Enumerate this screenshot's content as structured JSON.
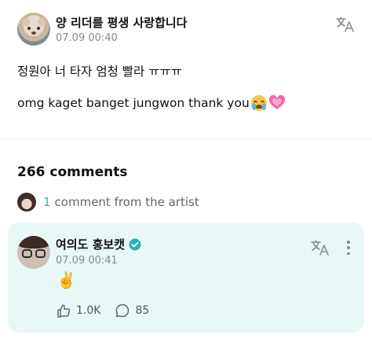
{
  "post": {
    "author": "양 리더를 평생 사랑합니다",
    "timestamp": "07.09 00:40",
    "body_line1": "정원아 너 타자 엄청 빨라 ㅠㅠㅠ",
    "body_line2": "omg kaget banget jungwon thank you",
    "emojis": [
      "loudly-crying-face",
      "growing-heart"
    ]
  },
  "comments": {
    "count_label": "266 comments",
    "artist_count": "1",
    "artist_text": "comment from the artist"
  },
  "artist_comment": {
    "author": "여의도 홍보캣",
    "timestamp": "07.09 00:41",
    "body": "✌️",
    "like_count": "1.0K",
    "reply_count": "85"
  },
  "icons": [
    "translate-icon",
    "more-options-icon",
    "verified-icon",
    "like-icon",
    "reply-icon"
  ],
  "colors": {
    "accent": "#2bb3b1",
    "card_background": "#e9f8f7",
    "muted_text": "#8a8a8a"
  }
}
